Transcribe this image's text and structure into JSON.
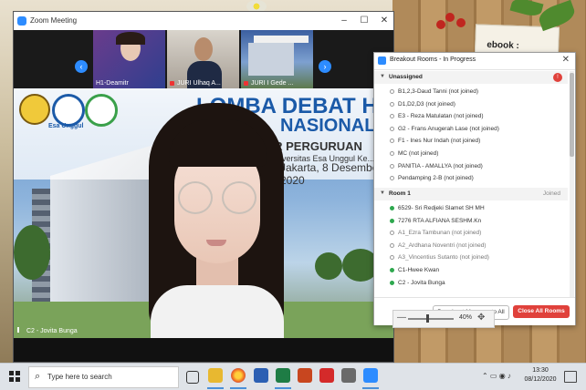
{
  "zoom": {
    "title": "Zoom Meeting",
    "thumbnails": [
      {
        "label": "H1-Deamitr"
      },
      {
        "label": "JURI Ulhaq A..."
      },
      {
        "label": "JURI I Gede ..."
      }
    ],
    "video": {
      "speaker_label": "C2 - Jovita Bunga",
      "banner_line1": "LOMBA DEBAT HUKUM",
      "banner_line1b": "NASIONAL",
      "banner_line2": "ANTAR PERGURUAN TINGGI",
      "banner_line3": "Dies Natalis Universitas Esa Unggul Ke...",
      "banner_line4": "Jakarta, 8 Desember 2020",
      "logo_text": "Esa Unggul"
    }
  },
  "desktop": {
    "note_text": "ebook :"
  },
  "breakout": {
    "title": "Breakout Rooms - In Progress",
    "unassigned": {
      "label": "Unassigned",
      "badge": "!",
      "participants": [
        "B1,2,3-Daud Tanni (not joined)",
        "D1,D2,D3 (not joined)",
        "E3 - Reza Matulatan (not joined)",
        "G2 - Frans Anugerah Lase (not joined)",
        "F1 - Ines Nur Indah (not joined)",
        "MC (not joined)",
        "PANITIA - AMALLYA (not joined)",
        "Pendamping 2-B (not joined)"
      ]
    },
    "room1": {
      "label": "Room 1",
      "status": "Joined",
      "participants": [
        {
          "name": "6529- Sri Redjeki Slamet SH MH",
          "joined": true
        },
        {
          "name": "7276 RTA ALFIANA SESHM.Kn",
          "joined": true
        },
        {
          "name": "A1_Ezra Tambunan (not joined)",
          "joined": false
        },
        {
          "name": "A2_Ardhana Noventri (not joined)",
          "joined": false
        },
        {
          "name": "A3_Vincentius Sutanto (not joined)",
          "joined": false
        },
        {
          "name": "C1-Hwee Kwan",
          "joined": true
        },
        {
          "name": "C2 - Jovita Bunga",
          "joined": true
        }
      ]
    },
    "broadcast_label": "Broadcast Message to All",
    "close_all_label": "Close All Rooms"
  },
  "zoom_level": "40%",
  "taskbar": {
    "search_placeholder": "Type here to search",
    "time": "13:30",
    "date": "08/12/2020",
    "apps": [
      "task-view",
      "file-explorer",
      "firefox",
      "word",
      "excel",
      "powerpoint",
      "app-red",
      "app-store",
      "zoom"
    ]
  },
  "colors": {
    "accent": "#2d8cff",
    "danger": "#e0413b",
    "online": "#2fa84f"
  }
}
